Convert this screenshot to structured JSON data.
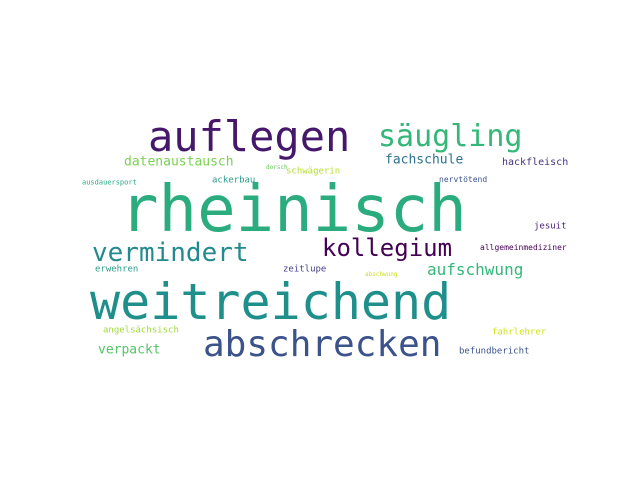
{
  "words": [
    {
      "id": "rheinisch",
      "text": "rheinisch",
      "color": "#2aac7f"
    },
    {
      "id": "weitreichend",
      "text": "weitreichend",
      "color": "#1f8f8b"
    },
    {
      "id": "auflegen",
      "text": "auflegen",
      "color": "#45186c"
    },
    {
      "id": "abschrecken",
      "text": "abschrecken",
      "color": "#3b528b"
    },
    {
      "id": "saeugling",
      "text": "säugling",
      "color": "#35b779"
    },
    {
      "id": "vermindert",
      "text": "vermindert",
      "color": "#238a8d"
    },
    {
      "id": "kollegium",
      "text": "kollegium",
      "color": "#440154"
    },
    {
      "id": "aufschwung",
      "text": "aufschwung",
      "color": "#35b779"
    },
    {
      "id": "datenaustausch",
      "text": "datenaustausch",
      "color": "#7ad151"
    },
    {
      "id": "fachschule",
      "text": "fachschule",
      "color": "#2c728e"
    },
    {
      "id": "verpackt",
      "text": "verpackt",
      "color": "#54c568"
    },
    {
      "id": "hackfleisch",
      "text": "hackfleisch",
      "color": "#46327e"
    },
    {
      "id": "schwaegerin",
      "text": "schwägerin",
      "color": "#b5de2b"
    },
    {
      "id": "dorsch",
      "text": "dorsch",
      "color": "#6ccd5a"
    },
    {
      "id": "ausdauersport",
      "text": "ausdauersport",
      "color": "#26a784"
    },
    {
      "id": "ackerbau",
      "text": "ackerbau",
      "color": "#2a9a8b"
    },
    {
      "id": "nervtoetend",
      "text": "nervtötend",
      "color": "#3b528b"
    },
    {
      "id": "jesuit",
      "text": "jesuit",
      "color": "#482173"
    },
    {
      "id": "allgemeinmediziner",
      "text": "allgemeinmediziner",
      "color": "#440154"
    },
    {
      "id": "erwehren",
      "text": "erwehren",
      "color": "#2c9d8a"
    },
    {
      "id": "zeitlupe",
      "text": "zeitlupe",
      "color": "#433e85"
    },
    {
      "id": "abschwung",
      "text": "abschwung",
      "color": "#cde11d"
    },
    {
      "id": "angelsaechsisch",
      "text": "angelsächsisch",
      "color": "#a0da39"
    },
    {
      "id": "fahrlehrer",
      "text": "fahrlehrer",
      "color": "#d0e11c"
    },
    {
      "id": "befundbericht",
      "text": "befundbericht",
      "color": "#3b528b"
    }
  ]
}
